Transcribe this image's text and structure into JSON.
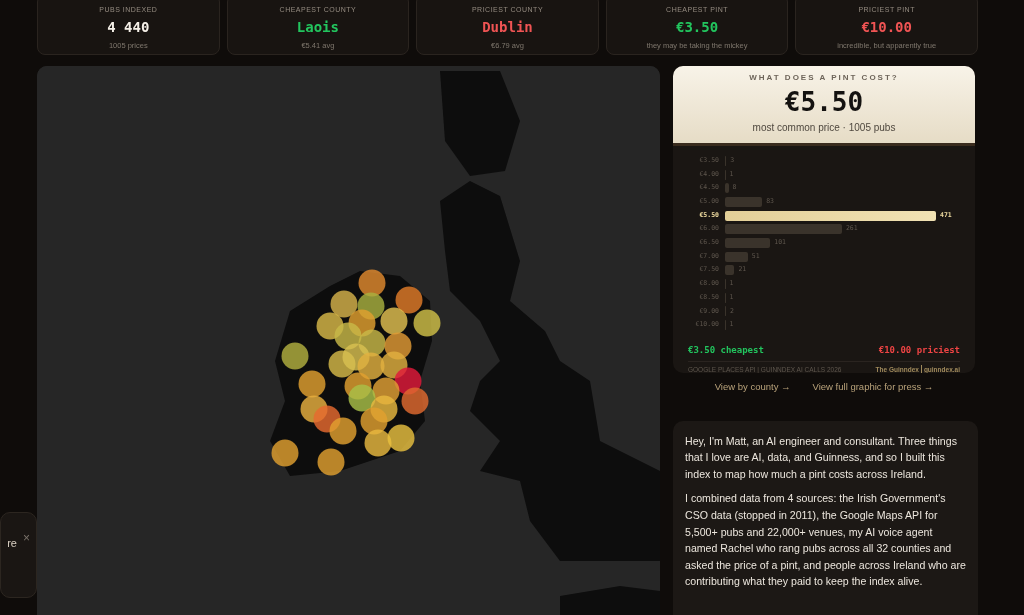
{
  "stats": [
    {
      "label": "PUBS INDEXED",
      "value": "4 440",
      "color": "#f5f0e8",
      "note": "1005 prices"
    },
    {
      "label": "CHEAPEST COUNTY",
      "value": "Laois",
      "color": "#22c55e",
      "note": "€5.41 avg"
    },
    {
      "label": "PRICIEST COUNTY",
      "value": "Dublin",
      "color": "#f05454",
      "note": "€6.79 avg"
    },
    {
      "label": "CHEAPEST PINT",
      "value": "€3.50",
      "color": "#22c55e",
      "note": "they may be taking the mickey"
    },
    {
      "label": "PRICIEST PINT",
      "value": "€10.00",
      "color": "#f05454",
      "note": "incredible, but apparently true"
    }
  ],
  "toast": {
    "text": "re",
    "close": "×"
  },
  "price_card": {
    "eyebrow": "WHAT DOES A PINT COST?",
    "price": "€5.50",
    "subtitle": "most common price · 1005 pubs",
    "chart_data": {
      "type": "bar",
      "orientation": "horizontal",
      "data_labels": true,
      "categories": [
        "€3.50",
        "€4.00",
        "€4.50",
        "€5.00",
        "€5.50",
        "€6.00",
        "€6.50",
        "€7.00",
        "€7.50",
        "€8.00",
        "€8.50",
        "€9.00",
        "€10.00"
      ],
      "values": [
        3,
        1,
        8,
        83,
        471,
        261,
        101,
        51,
        21,
        1,
        1,
        2,
        1
      ]
    },
    "cheapest": "€3.50 cheapest",
    "priciest": "€10.00 priciest",
    "source": "GOOGLE PLACES API | GUINNDEX AI CALLS 2026",
    "brand": "The Guinndex",
    "site": "guinndex.ai"
  },
  "links": [
    "View by county →",
    "View full graphic for press →"
  ],
  "about": [
    "Hey, I'm Matt, an AI engineer and consultant. Three things that I love are AI, data, and Guinness, and so I built this index to map how much a pint costs across Ireland.",
    "I combined data from 4 sources: the Irish Government's CSO data (stopped in 2011), the Google Maps API for 5,500+ pubs and 22,000+ venues, my AI voice agent named Rachel who rang pubs across all 32 counties and asked the price of a pint, and people across Ireland who are contributing what they paid to keep the index alive."
  ]
}
